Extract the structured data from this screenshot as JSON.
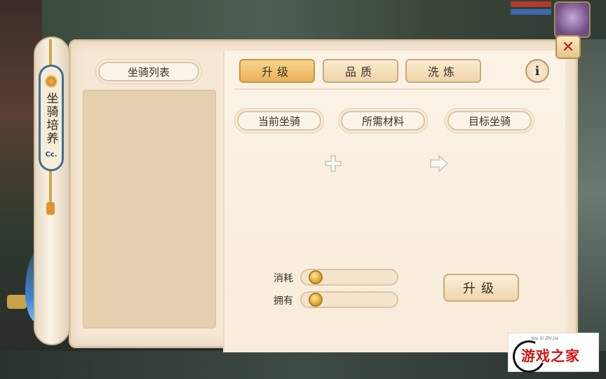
{
  "scroll": {
    "title": "坐骑培养",
    "mark": "Cc."
  },
  "mount_list": {
    "label": "坐骑列表"
  },
  "tabs": [
    {
      "label": "升级",
      "active": true
    },
    {
      "label": "品质",
      "active": false
    },
    {
      "label": "洗炼",
      "active": false
    }
  ],
  "info_label": "i",
  "close_label": "✕",
  "slots": {
    "current": "当前坐骑",
    "materials": "所需材料",
    "target": "目标坐骑"
  },
  "cost": {
    "consume_label": "消耗",
    "owned_label": "拥有",
    "consume_value": "",
    "owned_value": ""
  },
  "upgrade_button": "升级",
  "watermark": {
    "small": "You Xi Zhi Jia",
    "text": "游戏之家"
  },
  "colors": {
    "accent": "#eab35a",
    "close": "#c21f1f",
    "plaque_border": "#3f6e96"
  }
}
